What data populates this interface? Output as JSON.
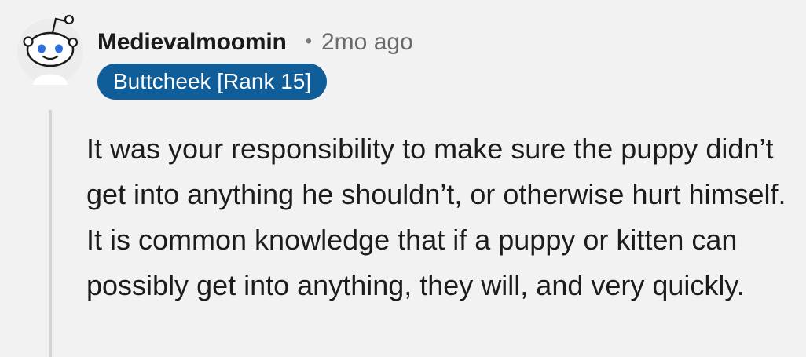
{
  "comment": {
    "author": "Medievalmoomin",
    "separator": "•",
    "timestamp": "2mo ago",
    "flair": "Buttcheek [Rank 15]",
    "body": "It was your responsibility to make sure the puppy didn’t get into anything he shouldn’t, or otherwise hurt himself. It is common knowledge that if a puppy or kitten can possibly get into anything, they will, and very quickly."
  },
  "colors": {
    "background": "#f2f2f2",
    "flair_background": "#0f5e9a",
    "flair_text": "#ffffff",
    "username": "#1a1a1b",
    "meta_text": "#6a6a6a",
    "thread_line": "#d4d4d4"
  },
  "icons": {
    "avatar": "reddit-snoo-avatar-icon"
  }
}
